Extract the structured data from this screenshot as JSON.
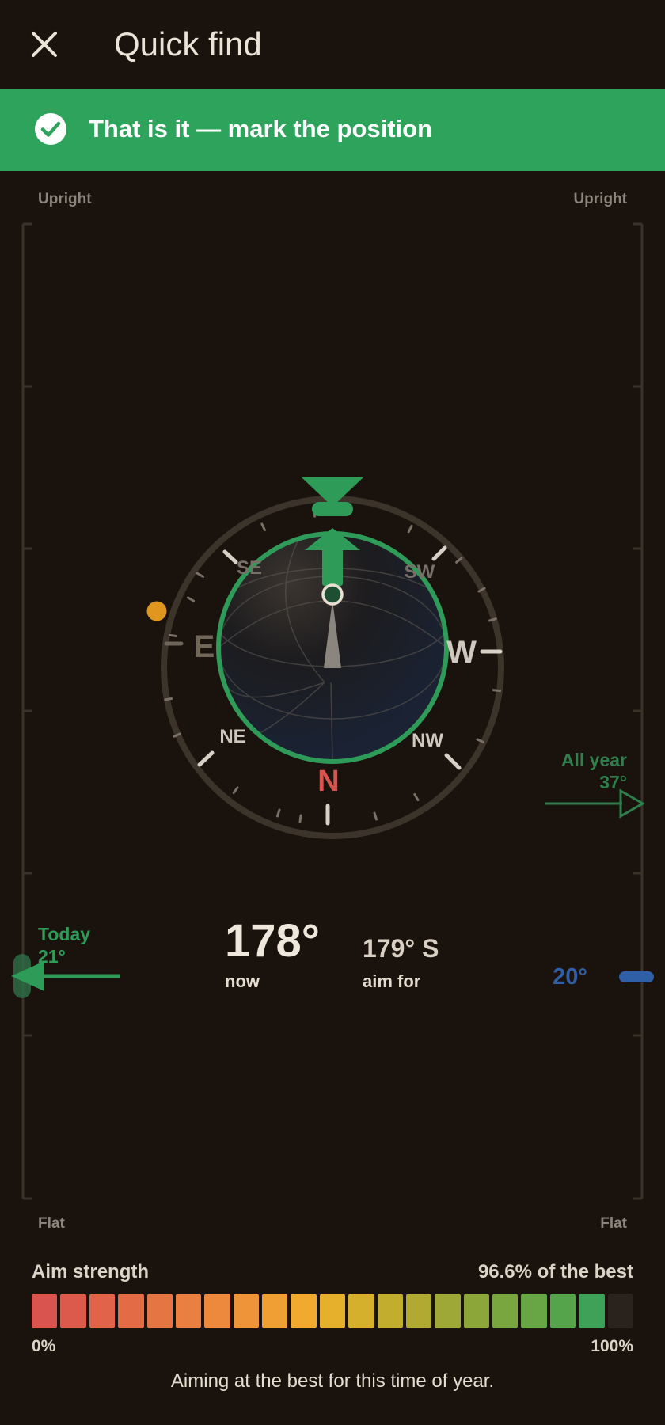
{
  "header": {
    "title": "Quick find",
    "close_icon": "close-icon"
  },
  "banner": {
    "text": "That is it — mark the position",
    "icon": "check-circle-icon",
    "color": "#2ea35b"
  },
  "tilt_scale": {
    "top_label_left": "Upright",
    "top_label_right": "Upright",
    "bottom_label_left": "Flat",
    "bottom_label_right": "Flat",
    "today": {
      "label": "Today",
      "value": "21°"
    },
    "all_year": {
      "label": "All year",
      "value": "37°"
    },
    "current": {
      "value": "20°",
      "color": "#2f5fa6"
    }
  },
  "compass": {
    "labels": {
      "n": "N",
      "e": "E",
      "w": "W",
      "ne": "NE",
      "nw": "NW",
      "se": "SE",
      "sw": "SW"
    },
    "ring_color": "#2ea35b",
    "north_color": "#d9534f",
    "sun_color": "#e0961f"
  },
  "readouts": {
    "now_value": "178°",
    "now_label": "now",
    "aim_value": "179° S",
    "aim_label": "aim for"
  },
  "strength": {
    "label": "Aim strength",
    "percent_text": "96.6% of the best",
    "fraction": 0.966,
    "min_label": "0%",
    "max_label": "100%",
    "segment_colors": [
      "#d9534f",
      "#dc5a4c",
      "#e0634a",
      "#e36c47",
      "#e67544",
      "#e97f41",
      "#ec893d",
      "#ef9439",
      "#f09f34",
      "#f2a92f",
      "#e6b02c",
      "#d4b02d",
      "#c2ad2f",
      "#b0aa32",
      "#9ea836",
      "#8ca63a",
      "#7aa63f",
      "#68a544",
      "#55a34a",
      "#3fa157"
    ],
    "empty_color": "#2a221c",
    "hint": "Aiming at the best for this time of year."
  }
}
